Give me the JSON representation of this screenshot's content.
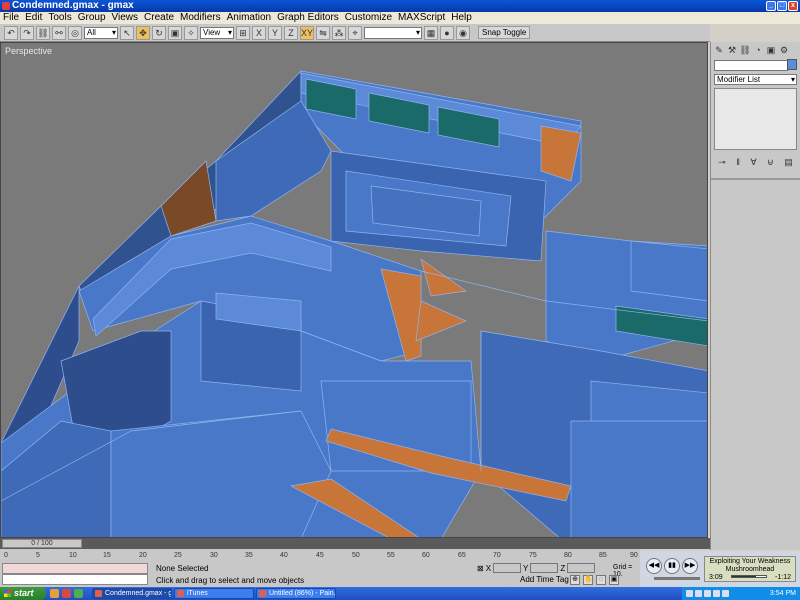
{
  "window": {
    "title": "Condemned.gmax - gmax"
  },
  "menu": [
    "File",
    "Edit",
    "Tools",
    "Group",
    "Views",
    "Create",
    "Modifiers",
    "Animation",
    "Graph Editors",
    "Customize",
    "MAXScript",
    "Help"
  ],
  "toolbar": {
    "selection_filter": "All",
    "reference_coord": "View",
    "named_selection": "",
    "snap_toggle": "Snap Toggle"
  },
  "viewport": {
    "label": "Perspective"
  },
  "command_panel": {
    "modifier_list": "Modifier List"
  },
  "time_slider": {
    "label": "0 / 100"
  },
  "timeline_ticks": [
    "0",
    "5",
    "10",
    "15",
    "20",
    "25",
    "30",
    "35",
    "40",
    "45",
    "50",
    "55",
    "60",
    "65",
    "70",
    "75",
    "80",
    "85",
    "90"
  ],
  "status": {
    "selection": "None Selected",
    "prompt": "Click and drag to select and move objects",
    "x_label": "X",
    "y_label": "Y",
    "z_label": "Z",
    "grid": "Grid = 10.",
    "add_time_tag": "Add Time Tag"
  },
  "media_player": {
    "track": "Exploiting Your Weakness",
    "artist": "Mushroomhead",
    "elapsed": "3:09",
    "remaining": "-1:12",
    "progress": 0.72
  },
  "taskbar": {
    "start": "start",
    "tasks": [
      "Condemned.gmax - g...",
      "iTunes",
      "Untitled (86%) - Pain..."
    ],
    "clock": "3:54 PM"
  },
  "colors": {
    "viewport_bg": "#7a7a7a",
    "mesh_blue": "#4a78c8",
    "mesh_orange": "#c8753a",
    "mesh_teal": "#1a6a6a"
  }
}
